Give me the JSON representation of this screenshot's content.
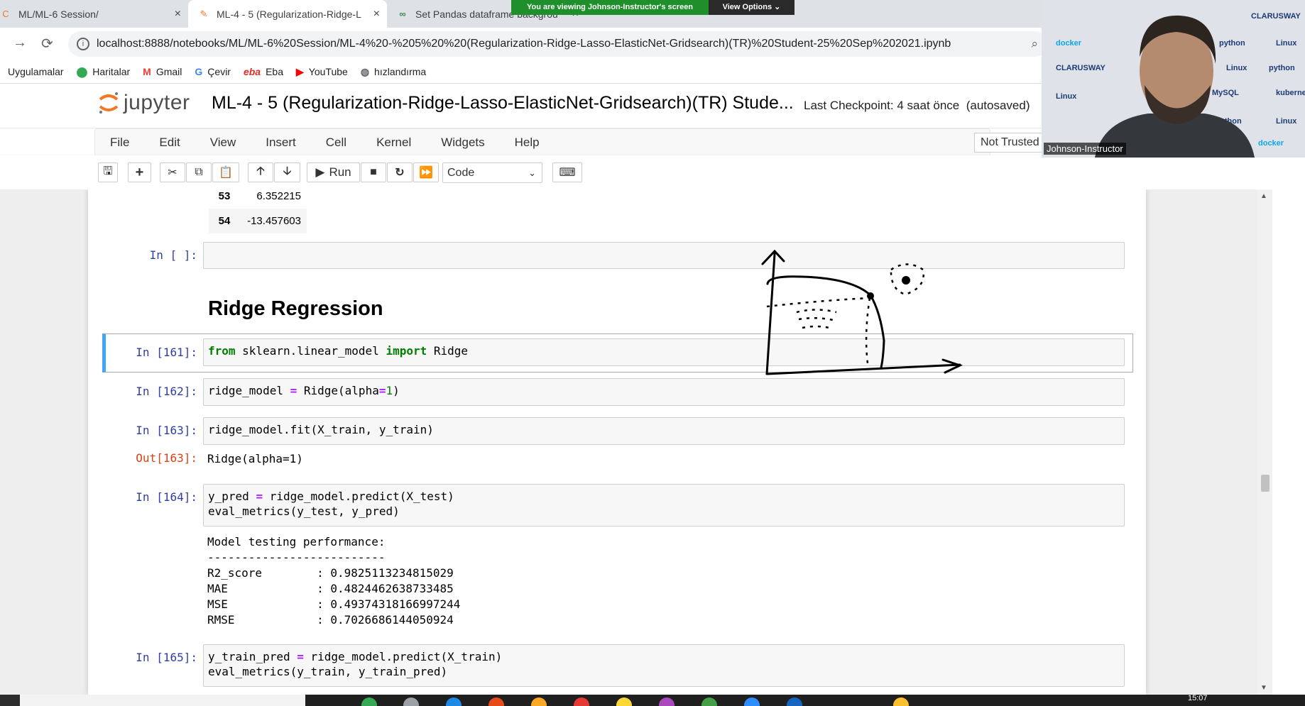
{
  "browser": {
    "tabs": [
      {
        "title": "ML/ML-6 Session/",
        "close": "×"
      },
      {
        "title": "ML-4 - 5 (Regularization-Ridge-L",
        "close": "×"
      },
      {
        "title": "Set Pandas dataframe background",
        "close": "×"
      }
    ],
    "share_banner": {
      "message": "You are viewing Johnson-Instructor's screen",
      "options": "View Options"
    },
    "url": "localhost:8888/notebooks/ML/ML-6%20Session/ML-4%20-%205%20%20(Regularization-Ridge-Lasso-ElasticNet-Gridsearch)(TR)%20Student-25%20Sep%202021.ipynb",
    "bookmarks": [
      "Uygulamalar",
      "Haritalar",
      "Gmail",
      "Çevir",
      "Eba",
      "YouTube",
      "hızlandırma"
    ]
  },
  "jupyter": {
    "logo_text": "jupyter",
    "notebook_title": "ML-4 - 5 (Regularization-Ridge-Lasso-ElasticNet-Gridsearch)(TR) Stude...",
    "checkpoint": "Last Checkpoint: 4 saat önce",
    "autosaved": "(autosaved)",
    "menu": [
      "File",
      "Edit",
      "View",
      "Insert",
      "Cell",
      "Kernel",
      "Widgets",
      "Help"
    ],
    "trust": "Not Trusted",
    "toolbar": {
      "run_label": "Run",
      "cell_type": "Code"
    }
  },
  "notebook": {
    "dataframe_tail": [
      {
        "index": "53",
        "value": "6.352215"
      },
      {
        "index": "54",
        "value": "-13.457603"
      }
    ],
    "empty_prompt": "In [ ]:",
    "heading": "Ridge Regression",
    "cells": {
      "c161": {
        "prompt": "In [161]:",
        "from": "from",
        "module": " sklearn.linear_model ",
        "import": "import",
        "name": " Ridge"
      },
      "c162": {
        "prompt": "In [162]:",
        "pre": "ridge_model ",
        "eq": "=",
        "mid": " Ridge(alpha",
        "eq2": "=",
        "num": "1",
        "post": ")"
      },
      "c163": {
        "prompt": "In [163]:",
        "code": "ridge_model.fit(X_train, y_train)",
        "out_prompt": "Out[163]:",
        "output": "Ridge(alpha=1)"
      },
      "c164": {
        "prompt": "In [164]:",
        "line1_pre": "y_pred ",
        "eq": "=",
        "line1_post": " ridge_model.predict(X_test)",
        "line2": "eval_metrics(y_test, y_pred)",
        "output": "Model testing performance:\n--------------------------\nR2_score        : 0.9825113234815029\nMAE             : 0.4824462638733485\nMSE             : 0.49374318166997244\nRMSE            : 0.7026686144050924"
      },
      "c165": {
        "prompt": "In [165]:",
        "line1_pre": "y_train_pred ",
        "eq": "=",
        "line1_post": " ridge_model.predict(X_train)",
        "line2": "eval_metrics(y_train, y_train_pred)"
      }
    }
  },
  "video": {
    "participant": "Johnson-Instructor"
  },
  "taskbar": {
    "clock": "15:07"
  }
}
